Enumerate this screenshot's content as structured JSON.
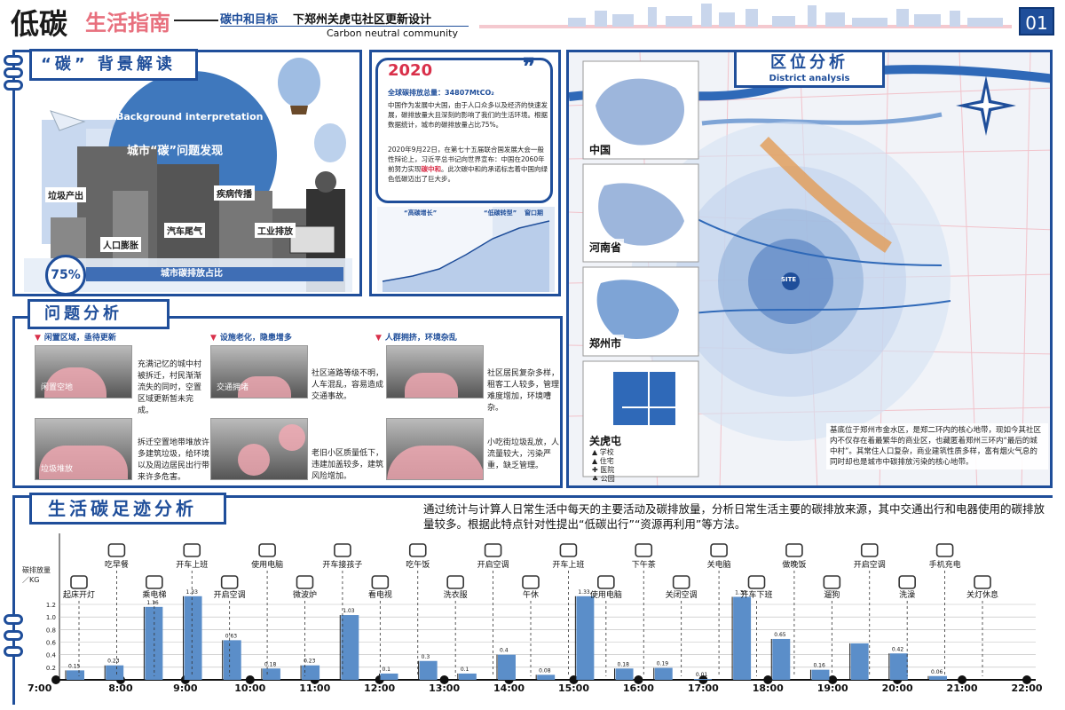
{
  "header": {
    "title_black": "低碳",
    "title_pink": "生活指南",
    "subtitle_a": "碳中和目标",
    "subtitle_b": "下郑州关虎屯社区更新设计",
    "subtitle_en": "Carbon neutral community",
    "page_number": "01"
  },
  "colors": {
    "primary": "#1f4e9a",
    "pink": "#e8707e",
    "bar": "#5b8ec9",
    "red": "#d9304a"
  },
  "background": {
    "title": "“碳”  背景解读",
    "en": "Background interpretation",
    "discover": "城市“碳”问题发现",
    "labels": [
      "垃圾产出",
      "疾病传播",
      "汽车尾气",
      "人口膨胀",
      "工业排放"
    ],
    "percent": "75%",
    "percent_caption": "城市碳排放占比"
  },
  "info": {
    "year": "2020",
    "total": "全球碳排放总量：34807MtCO₂",
    "p1": "中国作为发展中大国，由于人口众多以及经济的快速发展，碳排放量大且深刻的影响了我们的生活环境。根据数据统计，城市的碳排放量占比75%。",
    "p2_a": "2020年9月22日，在第七十五届联合国发展大会一般性辩论上，习近平总书记向世界宣布：中国在2060年前努力实现",
    "p2_hl": "碳中和",
    "p2_b": "。此次碳中和的承诺标志着中国向绿色低碳迈出了巨大步。",
    "chart_tags": [
      "“高碳增长”",
      "“低碳转型”",
      "窗口期"
    ]
  },
  "district": {
    "title": "区位分析",
    "en": "District analysis",
    "labels": [
      "中国",
      "河南省",
      "郑州市",
      "关虎屯"
    ],
    "legend": [
      "学校",
      "住宅",
      "医院",
      "公园"
    ],
    "site": "SITE",
    "description": "基底位于郑州市金水区，是郑二环内的核心地带，现如今其社区内不仅存在着最繁华的商业区，也藏匿着郑州三环内“最后的城中村”。其常住人口复杂，商业建筑性质多样，富有烟火气息的同时却也是城市中碳排放污染的核心地带。"
  },
  "problems": {
    "title": "问题分析",
    "categories": [
      "闲置区域，亟待更新",
      "设施老化，隐患增多",
      "人群拥挤，环境杂乱"
    ],
    "items": [
      {
        "label": "闲置空地",
        "text": "充满记忆的城中村被拆迁，村民渐渐流失的同时，空置区域更新暂未完成。"
      },
      {
        "label": "交通拥堵",
        "text": "社区道路等级不明，人车混乱，容易造成交通事故。"
      },
      {
        "label": "",
        "text": "社区居民复杂多样，租客工人较多，管理难度增加，环境嘈杂。"
      },
      {
        "label": "垃圾堆放",
        "text": "拆迁空置地带堆放许多建筑垃圾，给环境以及周边居民出行带来许多危害。"
      },
      {
        "label": "",
        "text": "老旧小区质量低下，违建加盖较多，建筑风险增加。"
      },
      {
        "label": "",
        "text": "小吃街垃圾乱放，人流量较大，污染严重，缺乏管理。"
      }
    ]
  },
  "footprint": {
    "title": "生活碳足迹分析",
    "desc": "通过统计与计算人日常生活中每天的主要活动及碳排放量，分析日常生活主要的碳排放来源，其中交通出行和电器使用的碳排放量较多。根据此特点针对性提出“低碳出行”“资源再利用”等方法。",
    "ylabel": "碳排放量／KG",
    "activities": [
      {
        "label": "起床开灯",
        "icon": "lightbulb-icon"
      },
      {
        "label": "吃早餐",
        "icon": "palette-icon"
      },
      {
        "label": "乘电梯",
        "icon": "elevator-icon"
      },
      {
        "label": "开车上班",
        "icon": "bus-icon"
      },
      {
        "label": "开启空调",
        "icon": "air-conditioner-icon"
      },
      {
        "label": "使用电脑",
        "icon": "computer-icon"
      },
      {
        "label": "微波炉",
        "icon": "microwave-icon"
      },
      {
        "label": "开车接孩子",
        "icon": "car-icon"
      },
      {
        "label": "看电视",
        "icon": "tv-icon"
      },
      {
        "label": "吃午饭",
        "icon": "egg-icon"
      },
      {
        "label": "洗衣服",
        "icon": "washer-icon"
      },
      {
        "label": "开启空调",
        "icon": "air-conditioner-icon"
      },
      {
        "label": "午休",
        "icon": "rest-icon"
      },
      {
        "label": "开车上班",
        "icon": "bus-icon"
      },
      {
        "label": "使用电脑",
        "icon": "computer-icon"
      },
      {
        "label": "下午茶",
        "icon": "tea-icon"
      },
      {
        "label": "关闭空调",
        "icon": "air-conditioner-icon"
      },
      {
        "label": "关电脑",
        "icon": "computer-icon"
      },
      {
        "label": "开车下班",
        "icon": "bus-icon"
      },
      {
        "label": "做晚饭",
        "icon": "burger-icon"
      },
      {
        "label": "遛狗",
        "icon": "dog-icon"
      },
      {
        "label": "开启空调",
        "icon": "air-conditioner-icon"
      },
      {
        "label": "洗澡",
        "icon": "shower-icon"
      },
      {
        "label": "手机充电",
        "icon": "phone-icon"
      },
      {
        "label": "关灯休息",
        "icon": "lightbulb-icon"
      }
    ]
  },
  "chart_data": {
    "type": "bar",
    "x_ticks": [
      "7:00",
      "8:00",
      "9:00",
      "10:00",
      "11:00",
      "12:00",
      "13:00",
      "14:00",
      "15:00",
      "16:00",
      "17:00",
      "18:00",
      "19:00",
      "20:00",
      "21:00",
      "22:00"
    ],
    "values": [
      0.15,
      0.23,
      1.16,
      1.33,
      0.63,
      0.18,
      0.23,
      1.03,
      0.1,
      0.3,
      0.1,
      0.4,
      0.08,
      1.33,
      0.18,
      0.19,
      0.01,
      1.32,
      0.65,
      0.16,
      0.58,
      0.42,
      0.06
    ],
    "value_labels": [
      "0.15",
      "0.23",
      "1.16",
      "1.33",
      "0.63",
      "0.18",
      "0.23",
      "1.03",
      "0.1",
      "0.3",
      "0.1",
      "0.4",
      "0.08",
      "1.33",
      "0.18",
      "0.19",
      "0.01",
      "1.32",
      "0.65",
      "0.16",
      "",
      "0.42",
      "0.06"
    ],
    "ylim": [
      0,
      1.4
    ],
    "yticks": [
      "0",
      "0.2",
      "0.4",
      "0.6",
      "0.8",
      "1.0",
      "1.2"
    ],
    "ylabel": "碳排放量／KG",
    "grid": true
  }
}
